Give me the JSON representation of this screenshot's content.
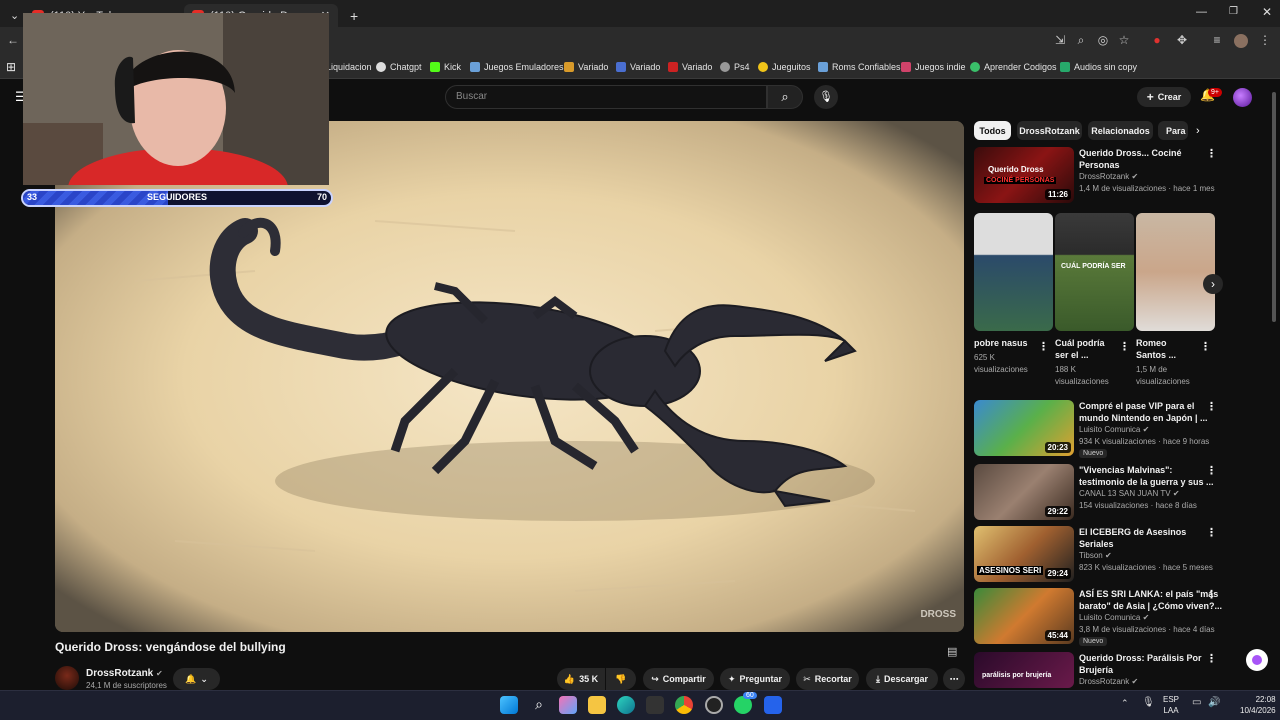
{
  "browser": {
    "tabs": [
      "(110) YouTube",
      "(110) Querido Dross"
    ],
    "new_tab": "+",
    "bookmarks": [
      "Liquidacion",
      "Chatgpt",
      "Kick",
      "Juegos Emuladores",
      "Variado",
      "Variado",
      "Variado",
      "Ps4",
      "Jueguitos",
      "Roms Confiables",
      "Juegos indie",
      "Aprender Codigos",
      "Audios sin copy"
    ]
  },
  "youtube": {
    "search_placeholder": "Buscar",
    "create_label": "Crear",
    "notif_badge": "9+"
  },
  "webcam": {
    "followers_left": "33",
    "followers_label": "SEGUIDORES",
    "followers_right": "70",
    "progress": 0.47
  },
  "video": {
    "title": "Querido Dross: vengándose del bullying",
    "watermark": "DROSS",
    "channel": "DrossRotzank",
    "subscribers": "24,1 M de suscriptores",
    "likes": "35 K",
    "actions": [
      "Compartir",
      "Preguntar",
      "Recortar",
      "Descargar"
    ]
  },
  "sidebar": {
    "chips": [
      "Todos",
      "DrossRotzank",
      "Relacionados",
      "Para"
    ],
    "first": {
      "title1": "Querido Dross... Cociné",
      "title2": "Personas",
      "channel": "DrossRotzank",
      "meta": "1,4 M de visualizaciones · hace 1 mes",
      "duration": "11:26",
      "thumb_text": "Querido Dross",
      "thumb_text2": "COCINÉ PERSONAS"
    },
    "shorts": [
      {
        "title1": "pobre nasus",
        "title2": "",
        "views1": "625 K",
        "views2": "visualizaciones"
      },
      {
        "title1": "Cuál podría",
        "title2": "ser el ...",
        "views1": "188 K",
        "views2": "visualizaciones"
      },
      {
        "title1": "Romeo",
        "title2": "Santos ...",
        "views1": "1,5 M de",
        "views2": "visualizaciones"
      }
    ],
    "short2_overlay": "CUÁL PODRÍA SER",
    "videos": [
      {
        "title1": "Compré el pase VIP para el",
        "title2": "mundo Nintendo en Japón | ...",
        "channel": "Luisito Comunica",
        "meta": "934 K visualizaciones · hace 9 horas",
        "duration": "20:23",
        "badge": "Nuevo"
      },
      {
        "title1": "\"Vivencias Malvinas\":",
        "title2": "testimonio de la guerra y sus ...",
        "channel": "CANAL 13 SAN JUAN TV",
        "meta": "154 visualizaciones · hace 8 días",
        "duration": "29:22",
        "badge": ""
      },
      {
        "title1": "El ICEBERG de Asesinos",
        "title2": "Seriales",
        "channel": "Tibson",
        "meta": "823 K visualizaciones · hace 5 meses",
        "duration": "29:24",
        "badge": "",
        "thumb_text": "ASESINOS SERI"
      },
      {
        "title1": "ASÍ ES SRI LANKA: el país \"más",
        "title2": "barato\" de Asia | ¿Cómo viven?...",
        "channel": "Luisito Comunica",
        "meta": "3,8 M de visualizaciones · hace 4 días",
        "duration": "45:44",
        "badge": "Nuevo"
      },
      {
        "title1": "Querido Dross: Parálisis Por",
        "title2": "Brujería",
        "channel": "DrossRotzank",
        "meta": "",
        "duration": "",
        "badge": "",
        "thumb_text": "parálisis por brujería"
      }
    ]
  },
  "taskbar": {
    "lang1": "ESP",
    "lang2": "LAA",
    "time": "22:08",
    "date": "10/4/2026",
    "badge": "60"
  }
}
